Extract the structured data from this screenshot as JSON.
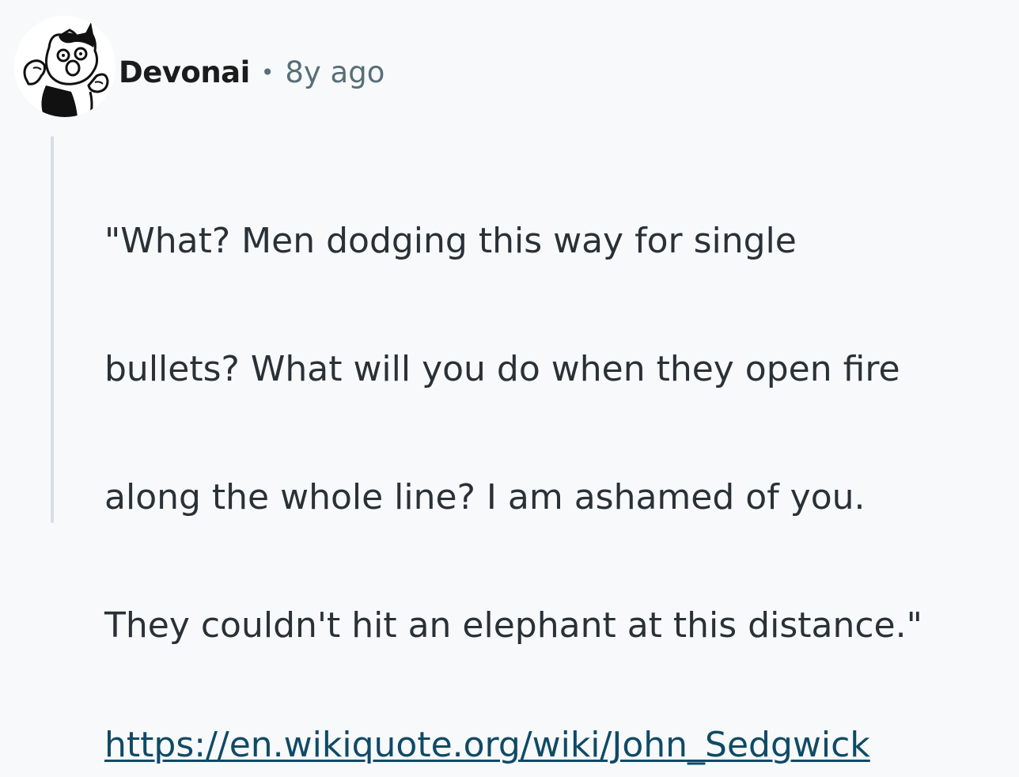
{
  "comment": {
    "author": "Devonai",
    "separator": "•",
    "time_ago": "8y ago",
    "avatar_icon": "cat-avatar-icon",
    "body_lines": [
      "\"What? Men dodging this way for single",
      "bullets? What will you do when they open fire",
      "along the whole line? I am ashamed of you.",
      "They couldn't hit an elephant at this distance.\""
    ],
    "link": {
      "text": "https://en.wikiquote.org/wiki/John_Sedgwick",
      "href": "https://en.wikiquote.org/wiki/John_Sedgwick"
    }
  },
  "colors": {
    "background": "#f7f9fb",
    "username": "#1c1c1c",
    "meta": "#576f76",
    "body_text": "#2a3136",
    "link": "#0f4a66",
    "thread_line": "#d7dfe2"
  }
}
